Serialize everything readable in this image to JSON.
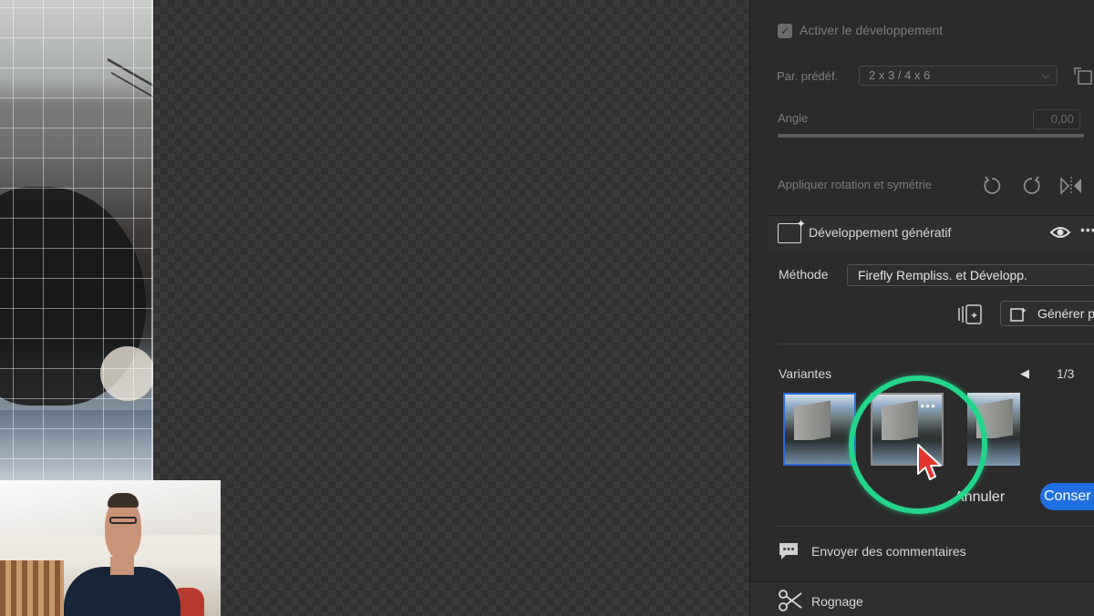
{
  "panel": {
    "enable_dev_label": "Activer le développement",
    "preset_label": "Par. prédéf.",
    "preset_value": "2 x 3  / 4 x 6",
    "angle_label": "Angle",
    "angle_value": "0,00",
    "rotate_label": "Appliquer rotation et symétrie"
  },
  "generative": {
    "title": "Développement génératif",
    "method_label": "Méthode",
    "method_value": "Firefly Rempliss. et Développ.",
    "generate_button": "Générer p"
  },
  "variants": {
    "label": "Variantes",
    "page": "1/3",
    "more": "•••",
    "cancel_button": "Annuler",
    "keep_button": "Conser"
  },
  "feedback": {
    "label": "Envoyer des commentaires"
  },
  "crop": {
    "label": "Rognage"
  },
  "icons": {
    "checkbox": "checkmark-icon",
    "flip": "flip-horizontal-icon",
    "rotate_left": "rotate-left-icon",
    "rotate_right": "rotate-right-icon",
    "eye": "eye-icon",
    "scissors": "scissors-icon",
    "comment": "comment-icon"
  },
  "colors": {
    "accent": "#1f6fe0",
    "highlight": "#23d58b",
    "cursor": "#e3342f"
  }
}
